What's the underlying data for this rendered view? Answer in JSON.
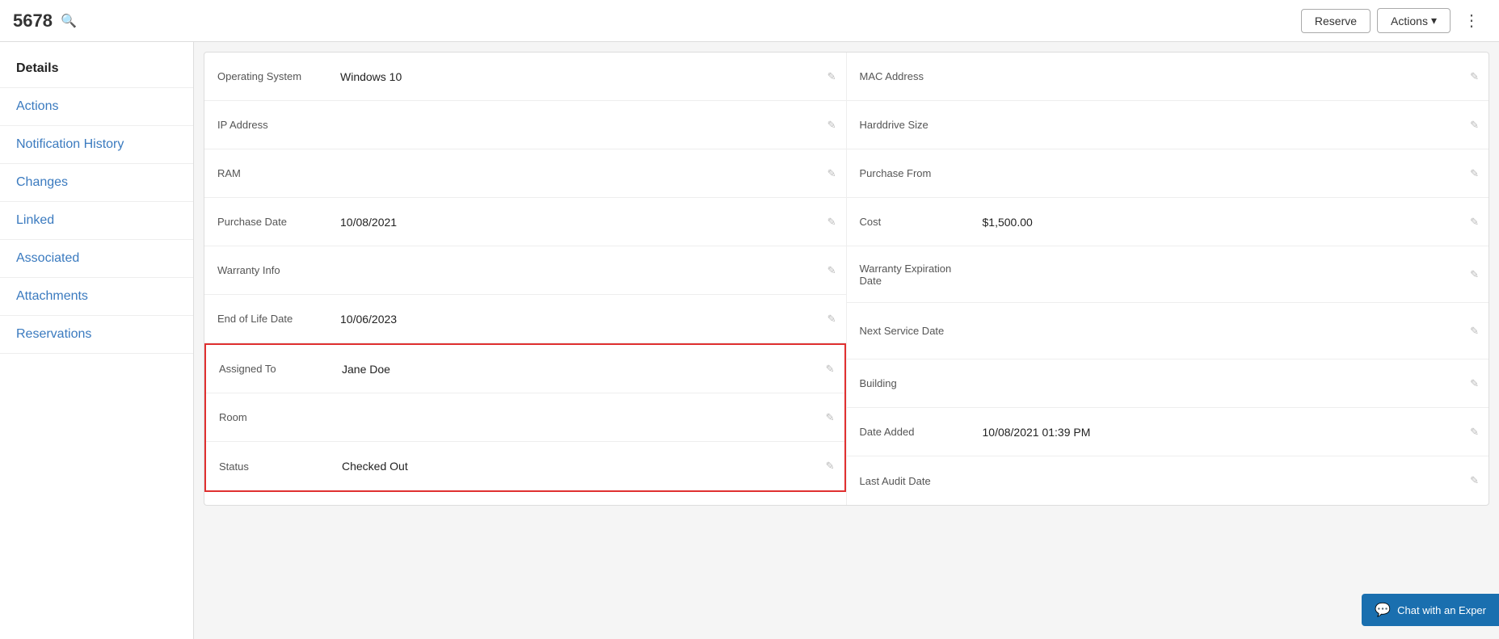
{
  "header": {
    "asset_id": "5678",
    "reserve_label": "Reserve",
    "actions_label": "Actions",
    "more_icon": "⋮",
    "search_icon": "🔍"
  },
  "sidebar": {
    "items": [
      {
        "id": "details",
        "label": "Details",
        "active": true
      },
      {
        "id": "actions",
        "label": "Actions",
        "active": false
      },
      {
        "id": "notification-history",
        "label": "Notification History",
        "active": false
      },
      {
        "id": "changes",
        "label": "Changes",
        "active": false
      },
      {
        "id": "linked",
        "label": "Linked",
        "active": false
      },
      {
        "id": "associated",
        "label": "Associated",
        "active": false
      },
      {
        "id": "attachments",
        "label": "Attachments",
        "active": false
      },
      {
        "id": "reservations",
        "label": "Reservations",
        "active": false
      }
    ]
  },
  "detail_fields": {
    "left_col": [
      {
        "label": "Operating System",
        "value": "Windows 10"
      },
      {
        "label": "IP Address",
        "value": ""
      },
      {
        "label": "RAM",
        "value": ""
      },
      {
        "label": "Purchase Date",
        "value": "10/08/2021"
      },
      {
        "label": "Warranty Info",
        "value": ""
      },
      {
        "label": "End of Life Date",
        "value": "10/06/2023"
      }
    ],
    "highlighted": [
      {
        "label": "Assigned To",
        "value": "Jane Doe"
      },
      {
        "label": "Room",
        "value": ""
      },
      {
        "label": "Status",
        "value": "Checked Out"
      }
    ],
    "right_col": [
      {
        "label": "MAC Address",
        "value": ""
      },
      {
        "label": "Harddrive Size",
        "value": ""
      },
      {
        "label": "Purchase From",
        "value": ""
      },
      {
        "label": "Cost",
        "value": "$1,500.00"
      },
      {
        "label": "Warranty Expiration Date",
        "value": ""
      },
      {
        "label": "Next Service Date",
        "value": ""
      },
      {
        "label": "Building",
        "value": ""
      },
      {
        "label": "Date Added",
        "value": "10/08/2021 01:39 PM"
      },
      {
        "label": "Last Audit Date",
        "value": ""
      }
    ]
  },
  "chat_widget": {
    "label": "Chat with an Exper",
    "icon": "💬"
  }
}
